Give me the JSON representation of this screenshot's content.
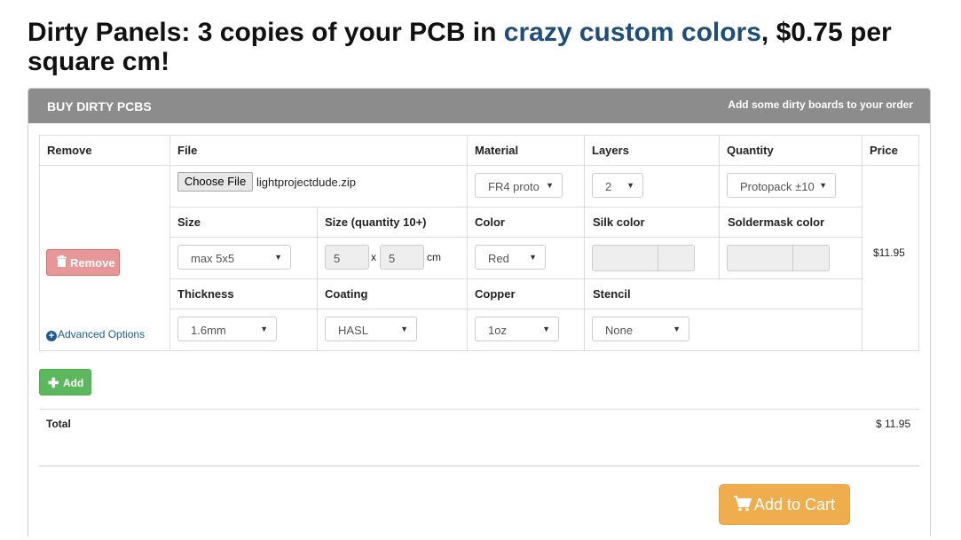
{
  "headline": {
    "part1": "Dirty Panels: 3 copies of your PCB in ",
    "highlight": "crazy custom colors",
    "part2": ", $0.75 per square cm!"
  },
  "panel": {
    "title": "BUY DIRTY PCBS",
    "subtitle": "Add some dirty boards to your order"
  },
  "table": {
    "headers": {
      "remove": "Remove",
      "file": "File",
      "material": "Material",
      "layers": "Layers",
      "quantity": "Quantity",
      "price": "Price"
    },
    "file": {
      "button_label": "Choose File",
      "filename": "lightprojectdude.zip"
    },
    "material": "FR4 proto",
    "layers": "2",
    "quantity": "Protopack ±10",
    "price": "$11.95",
    "sub_headers": {
      "size": "Size",
      "size_qty": "Size (quantity 10+)",
      "color": "Color",
      "silk_color": "Silk color",
      "soldermask_color": "Soldermask color"
    },
    "size": "max 5x5",
    "size_w": "5",
    "size_x": "x",
    "size_h": "5",
    "size_unit": "cm",
    "color": "Red",
    "remove_button": "Remove",
    "sub_headers2": {
      "thickness": "Thickness",
      "coating": "Coating",
      "copper": "Copper",
      "stencil": "Stencil"
    },
    "thickness": "1.6mm",
    "coating": "HASL",
    "copper": "1oz",
    "stencil": "None",
    "advanced_options": "Advanced Options"
  },
  "add_button": "Add",
  "total": {
    "label": "Total",
    "value": "$ 11.95"
  },
  "cart_button": "Add to Cart",
  "colors": {
    "headline_accent": "#1f4e7a",
    "panel_header": "#8c8c8c",
    "remove_button": "#e38585",
    "add_button": "#5cb85c",
    "cart_button": "#f0ad4e"
  }
}
